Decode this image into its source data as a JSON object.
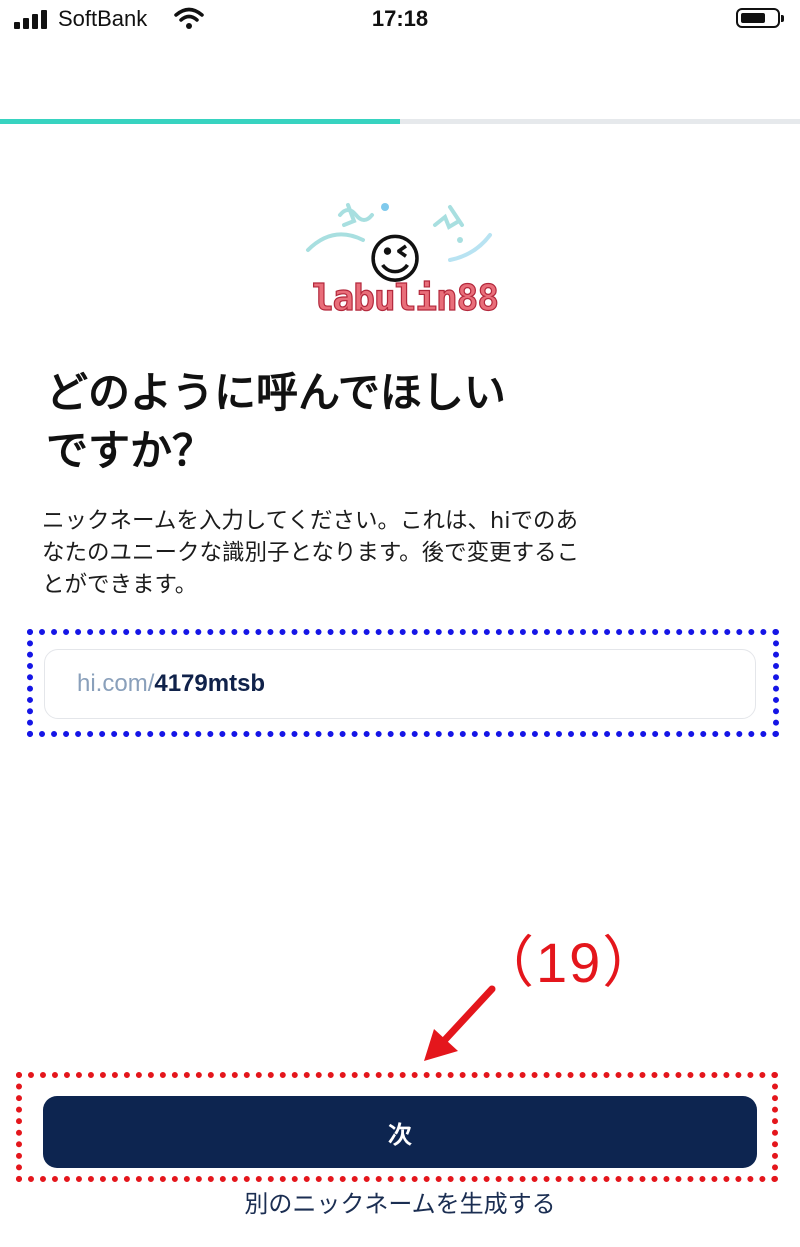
{
  "status_bar": {
    "carrier": "SoftBank",
    "time": "17:18"
  },
  "progress": {
    "fraction": 0.5,
    "color": "#37d3c0"
  },
  "profile": {
    "emoji": "😉",
    "username": "labulin88"
  },
  "title_line1": "どのように呼んでほしい",
  "title_line2": "ですか？",
  "description_line1": "ニックネームを入力してください。これは、hiでのあ",
  "description_line2": "なたのユニークな識別子となります。後で変更するこ",
  "description_line3": "とができます。",
  "nickname_input": {
    "prefix": "hi.com/",
    "value": "4179mtsb"
  },
  "annotation": {
    "step": "（19）",
    "color": "#e4161c"
  },
  "next_button_label": "次",
  "generate_link_label": "別のニックネームを生成する",
  "colors": {
    "primary": "#0d2550",
    "accent": "#37d3c0",
    "annotation_blue": "#1515e6"
  }
}
